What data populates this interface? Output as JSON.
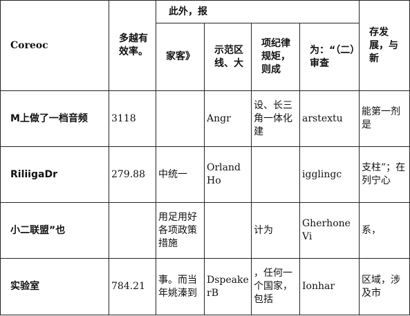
{
  "header": {
    "col1": "Coreoc",
    "col2": "多越有效率。",
    "group": "此外，报",
    "sub1": "家客》",
    "sub2": "示范区线、大",
    "sub3": "项纪律规矩，则成",
    "sub4": "为：“（二）审查",
    "col7": "存发展，与新"
  },
  "rows": [
    {
      "name": "M上做了一档音频",
      "num": "3118",
      "c3": "",
      "c4": "Angr",
      "c5": "设、长三角一体化建",
      "c6": "arstextu",
      "c7": "能第一剂是"
    },
    {
      "name": "RiliigaDr",
      "num": "279.88",
      "c3": "中统一",
      "c4": "OrlandHo",
      "c5": "",
      "c6": "igglingc",
      "c7": "支柱”；在列宁心"
    },
    {
      "name": "小二联盟”也",
      "num": "",
      "c3": "用足用好各项政策措施",
      "c4": "",
      "c5": "计为",
      "c6": "GherhoneVi",
      "c7": "系，"
    },
    {
      "name": "实验室",
      "num": "784.21",
      "c3": "事。而当年姚溱到",
      "c4": "DspeakerB",
      "c5": "，任何一个国家，包括",
      "c6": "Ionhar",
      "c7": "区域，涉及市"
    }
  ]
}
